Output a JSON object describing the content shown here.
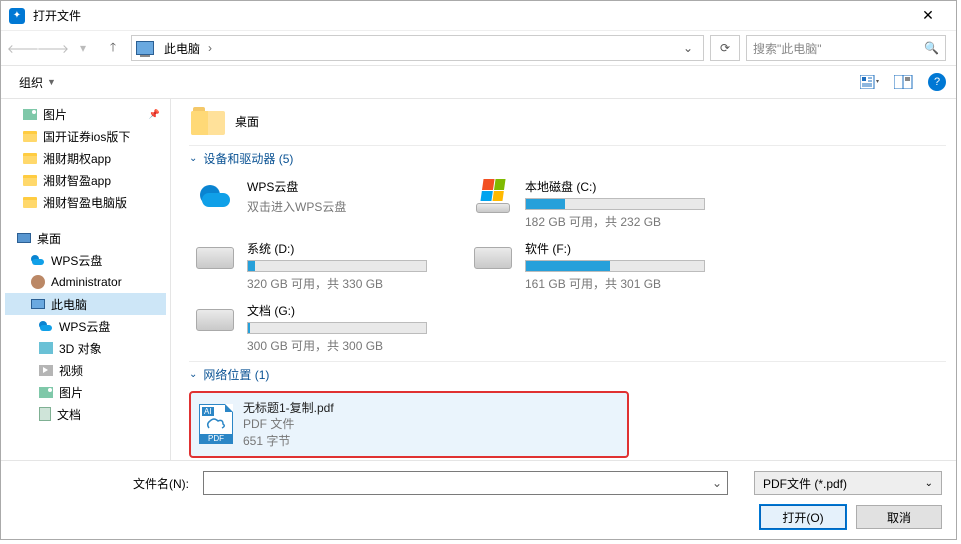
{
  "window": {
    "title": "打开文件"
  },
  "nav": {
    "breadcrumb": "此电脑",
    "search_placeholder": "搜索\"此电脑\""
  },
  "toolbar": {
    "organize": "组织"
  },
  "sidebar": {
    "items": [
      {
        "label": "图片",
        "icon": "pic",
        "pin": true
      },
      {
        "label": "国开证券ios版下",
        "icon": "folder"
      },
      {
        "label": "湘财期权app",
        "icon": "folder"
      },
      {
        "label": "湘财智盈app",
        "icon": "folder"
      },
      {
        "label": "湘财智盈电脑版",
        "icon": "folder"
      },
      {
        "label": "桌面",
        "icon": "desk",
        "top": true
      },
      {
        "label": "WPS云盘",
        "icon": "cloud",
        "indent": true
      },
      {
        "label": "Administrator",
        "icon": "user",
        "indent": true
      },
      {
        "label": "此电脑",
        "icon": "pc",
        "indent": true,
        "selected": true
      },
      {
        "label": "WPS云盘",
        "icon": "cloud",
        "indent2": true
      },
      {
        "label": "3D 对象",
        "icon": "3d",
        "indent2": true
      },
      {
        "label": "视频",
        "icon": "vid",
        "indent2": true
      },
      {
        "label": "图片",
        "icon": "pic",
        "indent2": true
      },
      {
        "label": "文档",
        "icon": "doc",
        "indent2": true
      }
    ]
  },
  "content": {
    "desktop_label": "桌面",
    "section_devices": "设备和驱动器 (5)",
    "section_network": "网络位置 (1)",
    "drives": [
      {
        "name": "WPS云盘",
        "sub": "双击进入WPS云盘",
        "type": "cloud"
      },
      {
        "name": "本地磁盘 (C:)",
        "sub": "182 GB 可用，共 232 GB",
        "type": "os",
        "fill": 22
      },
      {
        "name": "系统 (D:)",
        "sub": "320 GB 可用，共 330 GB",
        "type": "hdd",
        "fill": 4
      },
      {
        "name": "软件 (F:)",
        "sub": "161 GB 可用，共 301 GB",
        "type": "hdd",
        "fill": 47
      },
      {
        "name": "文档 (G:)",
        "sub": "300 GB 可用，共 300 GB",
        "type": "hdd",
        "fill": 1
      }
    ],
    "network_file": {
      "name": "无标题1-复制.pdf",
      "type": "PDF 文件",
      "size": "651 字节"
    }
  },
  "footer": {
    "filename_label": "文件名(N):",
    "filename_value": "",
    "filetype": "PDF文件 (*.pdf)",
    "open": "打开(O)",
    "cancel": "取消"
  }
}
